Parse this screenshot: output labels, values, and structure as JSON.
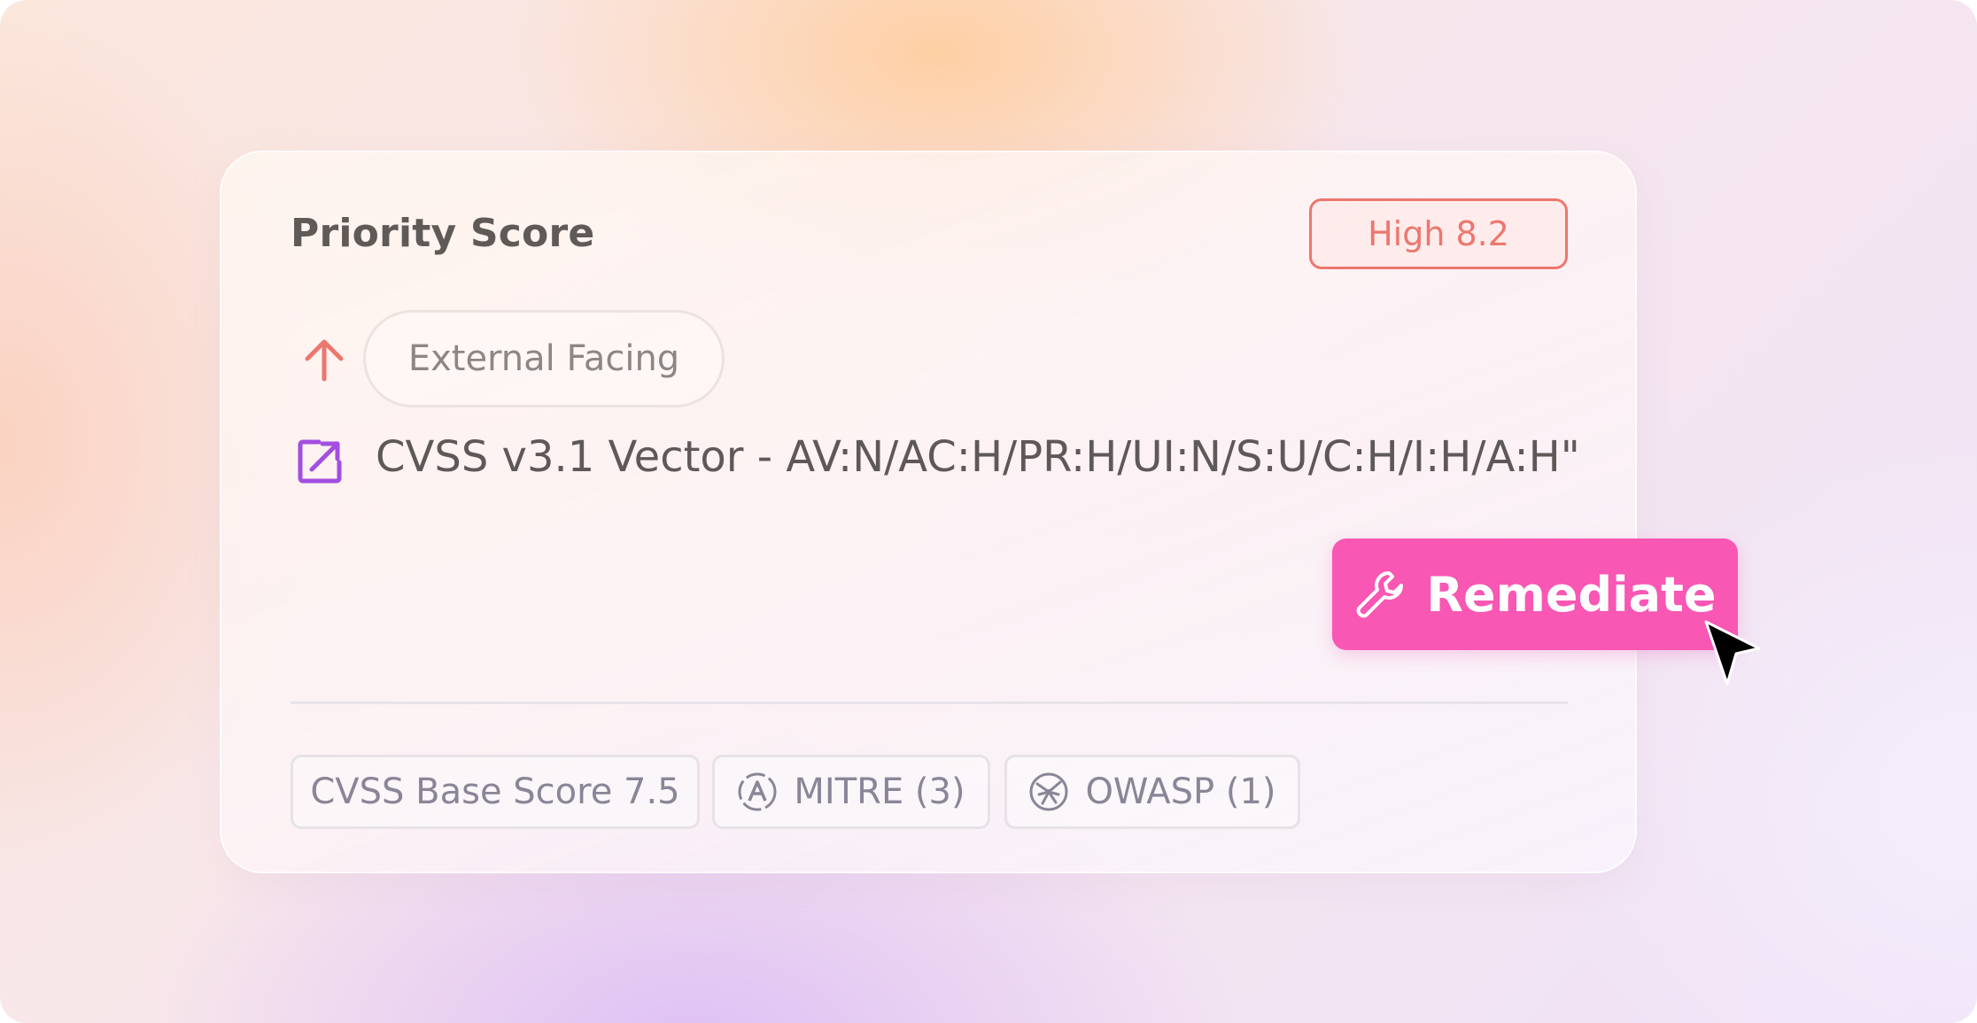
{
  "card": {
    "title": "Priority Score",
    "severity_badge": "High 8.2",
    "trend_icon": "arrow-up-icon",
    "exposure_tag": "External Facing",
    "cvss_vector_label": "CVSS v3.1 Vector -  AV:N/AC:H/PR:H/UI:N/S:U/C:H/I:H/A:H\"",
    "remediate_button": "Remediate",
    "tags": {
      "cvss_base": "CVSS Base Score 7.5",
      "mitre": "MITRE (3)",
      "owasp": "OWASP (1)"
    }
  },
  "colors": {
    "severity_red": "#ec776f",
    "link_purple": "#a24ee0",
    "remediate_pink": "#f857b3",
    "text_dark": "#5e5958",
    "tag_text": "#8a8597"
  },
  "icons": [
    "arrow-up-icon",
    "external-link-icon",
    "wrench-icon",
    "cursor-icon",
    "mitre-icon",
    "owasp-icon"
  ]
}
